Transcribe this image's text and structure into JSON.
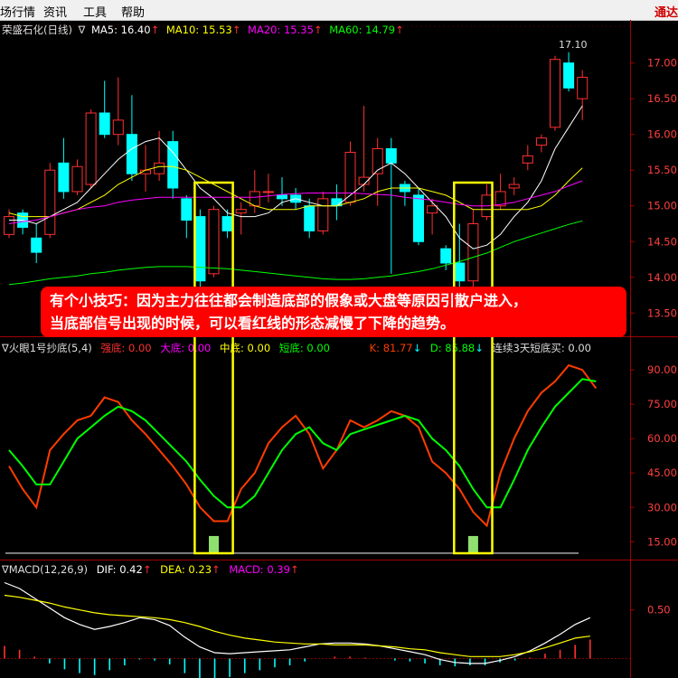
{
  "menu": {
    "items": [
      "场行情",
      "资讯",
      "工具",
      "帮助"
    ],
    "right_label": "通达"
  },
  "colors": {
    "up": "#ff3030",
    "down": "#00ffff",
    "ma5": "#ffffff",
    "ma10": "#ffff00",
    "ma20": "#ff00ff",
    "ma60": "#00ff00",
    "k": "#ff3c00",
    "d": "#00ff00",
    "highlight": "#ffff00",
    "dif": "#ffffff",
    "dea": "#ffff00"
  },
  "main_panel": {
    "title": "荣盛石化(日线)",
    "arrow": "∇",
    "indicators": [
      {
        "label": "MA5: 16.40",
        "color": "#ffffff"
      },
      {
        "label": "MA10: 15.53",
        "color": "#ffff00"
      },
      {
        "label": "MA20: 15.35",
        "color": "#ff00ff"
      },
      {
        "label": "MA60: 14.79",
        "color": "#00ff00"
      }
    ],
    "high_mark": "17.10"
  },
  "kdj_panel": {
    "title": "∇火眼1号抄底(5,4)",
    "indicators": [
      {
        "label": "强底: 0.00",
        "color": "#ff3030"
      },
      {
        "label": "大底: 0.00",
        "color": "#ff00ff"
      },
      {
        "label": "中底: 0.00",
        "color": "#ffff00"
      },
      {
        "label": "短底: 0.00",
        "color": "#00ff00"
      },
      {
        "label": "K: 81.77",
        "color": "#ff3c00"
      },
      {
        "label": "D: 85.88",
        "color": "#00ff00"
      },
      {
        "label": "连续3天短底买: 0.00",
        "color": "#dddddd"
      }
    ]
  },
  "macd_panel": {
    "title": "∇MACD(12,26,9)",
    "indicators": [
      {
        "label": "DIF: 0.42",
        "color": "#ffffff"
      },
      {
        "label": "DEA: 0.23",
        "color": "#ffff00"
      },
      {
        "label": "MACD: 0.39",
        "color": "#ff00ff"
      }
    ]
  },
  "annotation": {
    "line1": "有个小技巧：因为主力往往都会制造底部的假象或大盘等原因引散户进入，",
    "line2": "当底部信号出现的时候，可以看红线的形态减慢了下降的趋势。"
  },
  "chart_data": [
    {
      "type": "candlestick",
      "title": "荣盛石化(日线)",
      "yticks": [
        13.5,
        14.0,
        14.5,
        15.0,
        15.5,
        16.0,
        16.5,
        17.0
      ],
      "ylim": [
        13.2,
        17.35
      ],
      "candles": [
        {
          "o": 14.6,
          "h": 14.95,
          "l": 14.55,
          "c": 14.85
        },
        {
          "o": 14.9,
          "h": 14.95,
          "l": 14.6,
          "c": 14.7
        },
        {
          "o": 14.55,
          "h": 14.75,
          "l": 14.2,
          "c": 14.35
        },
        {
          "o": 14.6,
          "h": 15.6,
          "l": 14.55,
          "c": 15.5
        },
        {
          "o": 15.6,
          "h": 15.95,
          "l": 15.1,
          "c": 15.2
        },
        {
          "o": 15.2,
          "h": 15.65,
          "l": 15.15,
          "c": 15.55
        },
        {
          "o": 15.3,
          "h": 16.35,
          "l": 15.25,
          "c": 16.3
        },
        {
          "o": 16.3,
          "h": 16.75,
          "l": 15.95,
          "c": 16.0
        },
        {
          "o": 16.0,
          "h": 16.8,
          "l": 15.85,
          "c": 16.2
        },
        {
          "o": 16.0,
          "h": 16.55,
          "l": 15.35,
          "c": 15.45
        },
        {
          "o": 15.45,
          "h": 15.85,
          "l": 15.2,
          "c": 15.5
        },
        {
          "o": 15.45,
          "h": 16.05,
          "l": 15.35,
          "c": 15.6
        },
        {
          "o": 15.9,
          "h": 16.05,
          "l": 15.1,
          "c": 15.25
        },
        {
          "o": 15.1,
          "h": 15.15,
          "l": 14.55,
          "c": 14.8
        },
        {
          "o": 14.85,
          "h": 14.95,
          "l": 13.7,
          "c": 13.95
        },
        {
          "o": 14.05,
          "h": 15.0,
          "l": 14.0,
          "c": 14.95
        },
        {
          "o": 14.85,
          "h": 14.95,
          "l": 14.55,
          "c": 14.65
        },
        {
          "o": 14.9,
          "h": 15.05,
          "l": 14.6,
          "c": 14.95
        },
        {
          "o": 15.0,
          "h": 15.5,
          "l": 14.9,
          "c": 15.2
        },
        {
          "o": 15.2,
          "h": 15.45,
          "l": 15.05,
          "c": 15.2
        },
        {
          "o": 15.15,
          "h": 15.4,
          "l": 15.0,
          "c": 15.1
        },
        {
          "o": 15.15,
          "h": 15.25,
          "l": 14.95,
          "c": 15.05
        },
        {
          "o": 15.0,
          "h": 15.1,
          "l": 14.55,
          "c": 14.65
        },
        {
          "o": 14.65,
          "h": 15.2,
          "l": 14.6,
          "c": 15.1
        },
        {
          "o": 15.1,
          "h": 15.3,
          "l": 14.8,
          "c": 15.0
        },
        {
          "o": 15.05,
          "h": 15.9,
          "l": 15.0,
          "c": 15.75
        },
        {
          "o": 15.3,
          "h": 16.4,
          "l": 15.2,
          "c": 15.4
        },
        {
          "o": 15.45,
          "h": 15.95,
          "l": 15.0,
          "c": 15.8
        },
        {
          "o": 15.8,
          "h": 15.95,
          "l": 14.05,
          "c": 15.6
        },
        {
          "o": 15.3,
          "h": 15.35,
          "l": 15.0,
          "c": 15.2
        },
        {
          "o": 15.15,
          "h": 15.25,
          "l": 14.45,
          "c": 14.5
        },
        {
          "o": 14.9,
          "h": 15.1,
          "l": 14.6,
          "c": 15.0
        },
        {
          "o": 14.4,
          "h": 14.45,
          "l": 14.1,
          "c": 14.2
        },
        {
          "o": 14.2,
          "h": 14.75,
          "l": 13.85,
          "c": 13.95
        },
        {
          "o": 13.95,
          "h": 14.95,
          "l": 13.7,
          "c": 14.75
        },
        {
          "o": 14.85,
          "h": 15.3,
          "l": 14.8,
          "c": 15.15
        },
        {
          "o": 15.0,
          "h": 15.45,
          "l": 14.95,
          "c": 15.2
        },
        {
          "o": 15.25,
          "h": 15.4,
          "l": 15.15,
          "c": 15.3
        },
        {
          "o": 15.6,
          "h": 15.85,
          "l": 15.5,
          "c": 15.7
        },
        {
          "o": 15.85,
          "h": 16.0,
          "l": 15.75,
          "c": 15.95
        },
        {
          "o": 16.1,
          "h": 17.1,
          "l": 16.05,
          "c": 17.05
        },
        {
          "o": 17.0,
          "h": 17.15,
          "l": 16.6,
          "c": 16.65
        },
        {
          "o": 16.5,
          "h": 16.9,
          "l": 16.2,
          "c": 16.8
        }
      ],
      "ma_lines": [
        {
          "name": "MA5",
          "values": [
            14.8,
            14.8,
            14.75,
            14.85,
            14.95,
            15.05,
            15.25,
            15.45,
            15.65,
            15.8,
            15.9,
            15.95,
            15.75,
            15.5,
            15.25,
            15.1,
            14.9,
            14.85,
            14.85,
            14.9,
            15.05,
            15.1,
            15.05,
            15.0,
            15.0,
            15.15,
            15.3,
            15.5,
            15.6,
            15.45,
            15.25,
            15.05,
            14.85,
            14.55,
            14.4,
            14.45,
            14.6,
            14.85,
            15.05,
            15.35,
            15.8,
            16.1,
            16.4
          ]
        },
        {
          "name": "MA10",
          "values": [
            14.9,
            14.85,
            14.85,
            14.85,
            14.9,
            14.95,
            15.05,
            15.15,
            15.3,
            15.4,
            15.5,
            15.55,
            15.55,
            15.5,
            15.4,
            15.3,
            15.2,
            15.1,
            15.0,
            14.95,
            14.95,
            14.95,
            15.0,
            15.0,
            15.0,
            15.05,
            15.1,
            15.2,
            15.25,
            15.25,
            15.25,
            15.2,
            15.15,
            15.05,
            14.95,
            14.95,
            14.95,
            14.95,
            14.95,
            15.0,
            15.15,
            15.35,
            15.53
          ]
        },
        {
          "name": "MA20",
          "values": [
            14.75,
            14.78,
            14.8,
            14.85,
            14.9,
            14.95,
            14.98,
            15.0,
            15.05,
            15.08,
            15.1,
            15.12,
            15.12,
            15.12,
            15.12,
            15.12,
            15.12,
            15.12,
            15.12,
            15.14,
            15.16,
            15.17,
            15.18,
            15.18,
            15.18,
            15.18,
            15.17,
            15.16,
            15.15,
            15.12,
            15.1,
            15.08,
            15.05,
            15.02,
            15.0,
            15.0,
            15.02,
            15.05,
            15.1,
            15.15,
            15.2,
            15.28,
            15.35
          ]
        },
        {
          "name": "MA60",
          "values": [
            13.9,
            13.92,
            13.95,
            13.98,
            14.0,
            14.02,
            14.05,
            14.07,
            14.1,
            14.12,
            14.14,
            14.15,
            14.15,
            14.15,
            14.14,
            14.13,
            14.12,
            14.1,
            14.08,
            14.06,
            14.04,
            14.02,
            14.0,
            13.98,
            13.97,
            13.97,
            13.98,
            14.0,
            14.02,
            14.05,
            14.08,
            14.12,
            14.17,
            14.22,
            14.28,
            14.34,
            14.42,
            14.5,
            14.56,
            14.62,
            14.68,
            14.74,
            14.79
          ]
        }
      ]
    },
    {
      "type": "line",
      "title": "火眼1号抄底(5,4)",
      "yticks": [
        15,
        30,
        45,
        60,
        75,
        90
      ],
      "ylim": [
        8,
        96
      ],
      "series": [
        {
          "name": "K",
          "values": [
            48,
            38,
            30,
            55,
            62,
            68,
            70,
            78,
            76,
            68,
            62,
            55,
            48,
            40,
            30,
            24,
            24,
            38,
            45,
            58,
            65,
            70,
            62,
            47,
            55,
            68,
            65,
            68,
            72,
            70,
            65,
            50,
            45,
            38,
            28,
            22,
            45,
            60,
            72,
            80,
            85,
            92,
            90,
            82
          ]
        },
        {
          "name": "D",
          "values": [
            55,
            48,
            40,
            40,
            50,
            60,
            65,
            70,
            74,
            72,
            68,
            62,
            56,
            50,
            42,
            35,
            30,
            30,
            35,
            45,
            55,
            62,
            65,
            58,
            55,
            62,
            64,
            66,
            68,
            70,
            68,
            60,
            55,
            48,
            38,
            30,
            30,
            42,
            55,
            65,
            74,
            80,
            86,
            85
          ]
        }
      ],
      "signals": [
        15,
        34
      ],
      "highlight_ranges": [
        [
          14,
          16
        ],
        [
          33,
          35
        ]
      ]
    },
    {
      "type": "line",
      "title": "MACD(12,26,9)",
      "yticks": [
        0.5
      ],
      "ylim": [
        -0.2,
        0.85
      ],
      "series": [
        {
          "name": "DIF",
          "values": [
            0.78,
            0.72,
            0.62,
            0.52,
            0.42,
            0.35,
            0.3,
            0.33,
            0.37,
            0.42,
            0.4,
            0.34,
            0.22,
            0.12,
            0.06,
            0.05,
            0.06,
            0.07,
            0.08,
            0.09,
            0.12,
            0.15,
            0.16,
            0.16,
            0.15,
            0.13,
            0.1,
            0.07,
            0.04,
            -0.01,
            -0.04,
            -0.05,
            -0.05,
            -0.02,
            0.02,
            0.08,
            0.16,
            0.25,
            0.35,
            0.42
          ]
        },
        {
          "name": "DEA",
          "values": [
            0.65,
            0.63,
            0.6,
            0.57,
            0.53,
            0.5,
            0.47,
            0.45,
            0.44,
            0.43,
            0.42,
            0.4,
            0.37,
            0.33,
            0.28,
            0.24,
            0.21,
            0.19,
            0.17,
            0.16,
            0.15,
            0.15,
            0.14,
            0.14,
            0.14,
            0.13,
            0.12,
            0.1,
            0.09,
            0.06,
            0.04,
            0.02,
            0.02,
            0.02,
            0.04,
            0.07,
            0.11,
            0.16,
            0.21,
            0.23
          ]
        },
        {
          "name": "MACD",
          "values": [
            0.26,
            0.18,
            0.04,
            -0.1,
            -0.22,
            -0.3,
            -0.34,
            -0.24,
            -0.14,
            -0.02,
            -0.04,
            -0.12,
            -0.3,
            -0.42,
            -0.44,
            -0.38,
            -0.3,
            -0.24,
            -0.18,
            -0.14,
            -0.06,
            0.0,
            0.04,
            0.04,
            0.02,
            0.0,
            -0.04,
            -0.06,
            -0.1,
            -0.14,
            -0.16,
            -0.14,
            -0.14,
            -0.08,
            -0.04,
            0.02,
            0.1,
            0.18,
            0.28,
            0.39
          ]
        }
      ]
    }
  ]
}
